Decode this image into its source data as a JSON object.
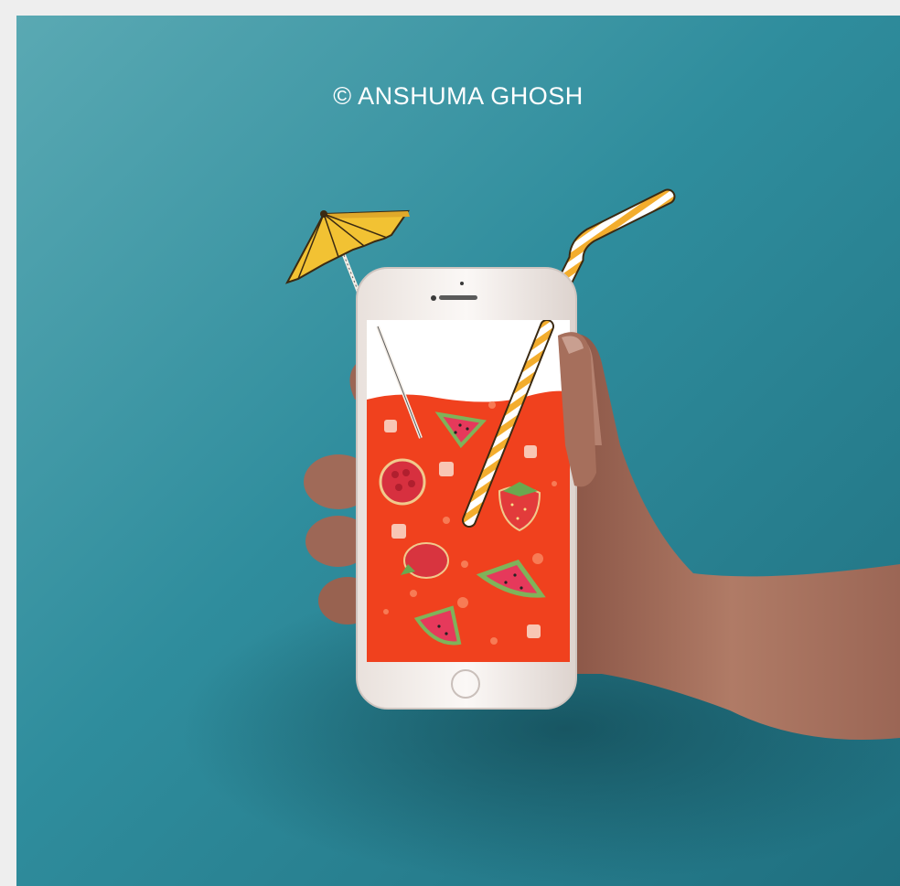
{
  "credit": {
    "text": "© ANSHUMA GHOSH"
  },
  "photo": {
    "subject_icons": [
      "smartphone",
      "hand",
      "cocktail-umbrella",
      "striped-straw",
      "watermelon-slice",
      "strawberry",
      "raspberry",
      "ice-cube",
      "bubble"
    ],
    "colors": {
      "background": "#2e8c9c",
      "drink": "#f0411e",
      "umbrella": "#f2c233",
      "straw": "#f3ad2d",
      "phone_body": "#f4eeea",
      "skin": "#a9705d"
    }
  }
}
